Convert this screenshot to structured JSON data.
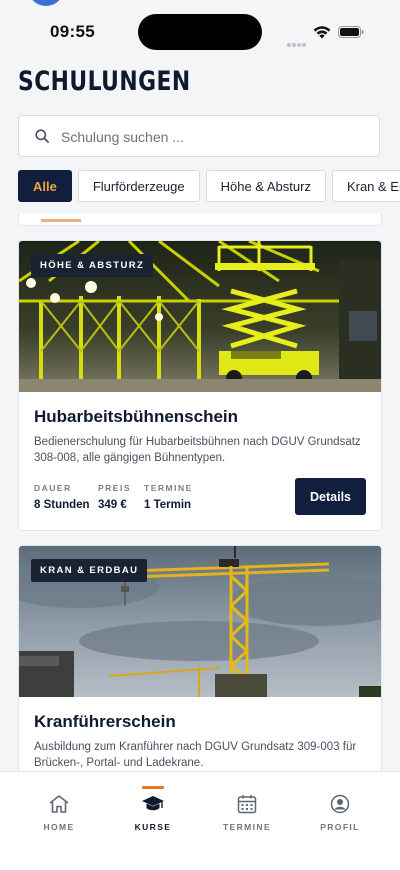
{
  "status_bar": {
    "time": "09:55"
  },
  "header": {
    "title": "SCHULUNGEN"
  },
  "search": {
    "placeholder": "Schulung suchen ..."
  },
  "filters": [
    "Alle",
    "Flurförderzeuge",
    "Höhe & Absturz",
    "Kran & Erdb"
  ],
  "courses": [
    {
      "category": "HÖHE & ABSTURZ",
      "title": "Hubarbeitsbühnenschein",
      "description": "Bedienerschulung für Hubarbeitsbühnen nach DGUV Grundsatz 308-008, alle gängigen Bühnentypen.",
      "duration_label": "DAUER",
      "duration": "8 Stunden",
      "price_label": "PREIS",
      "price": "349 €",
      "dates_label": "TERMINE",
      "dates": "1 Termin",
      "button": "Details"
    },
    {
      "category": "KRAN & ERDBAU",
      "title": "Kranführerschein",
      "description": "Ausbildung zum Kranführer nach DGUV Grundsatz 309-003 für Brücken-, Portal- und Ladekrane."
    }
  ],
  "tabbar": [
    {
      "label": "HOME",
      "icon": "home-icon"
    },
    {
      "label": "KURSE",
      "icon": "graduation-cap-icon",
      "active": true
    },
    {
      "label": "TERMINE",
      "icon": "calendar-icon"
    },
    {
      "label": "PROFIL",
      "icon": "profile-icon"
    }
  ],
  "colors": {
    "navy": "#0f1f3d",
    "accent": "#e8742c",
    "chip_active_text": "#f0a53a"
  }
}
